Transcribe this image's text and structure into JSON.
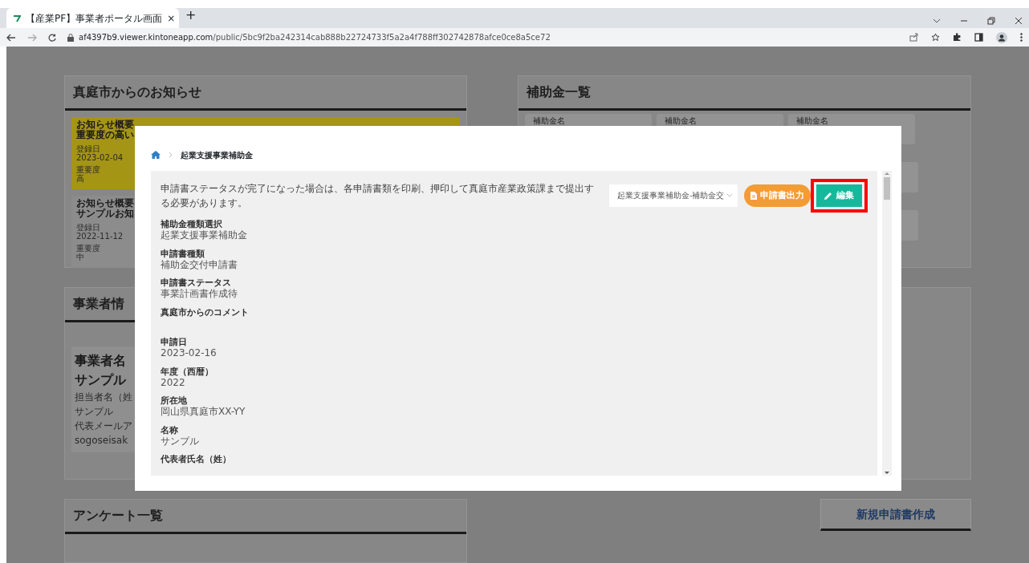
{
  "browser": {
    "tab_title": "【産業PF】事業者ポータル画面",
    "tab_close": "×",
    "new_tab": "+",
    "url_host": "af4397b9.viewer.kintoneapp.com",
    "url_path": "/public/5bc9f2ba242314cab888b22724733f5a2a4f788ff302742878afce0ce8a5ce72"
  },
  "page": {
    "notices": {
      "title": "真庭市からのお知らせ",
      "items": [
        {
          "lines": [
            "お知らせ概要",
            "重要度の高い"
          ],
          "date_label": "登録日",
          "date": "2023-02-04",
          "importance_label": "重要度",
          "importance": "高",
          "color": "#a59515"
        },
        {
          "lines": [
            "お知らせ概要",
            "サンプルお知"
          ],
          "date_label": "登録日",
          "date": "2022-11-12",
          "importance_label": "重要度",
          "importance": "中",
          "color": "#8c8c8c"
        }
      ]
    },
    "business": {
      "title": "事業者情",
      "card": {
        "name_label": "事業者名",
        "name": "サンプル",
        "lines": [
          "担当者名（姓",
          "サンプル",
          "代表メールア",
          "sogoseisak"
        ]
      }
    },
    "survey": {
      "title": "アンケート一覧"
    },
    "subsidies": {
      "title": "補助金一覧",
      "cards": [
        {
          "label": "補助金名"
        },
        {
          "label": "補助金名"
        },
        {
          "label": "補助金名"
        }
      ]
    },
    "new_button": "新規申請書作成"
  },
  "modal": {
    "breadcrumb": "起業支援事業補助金",
    "notice": "申請書ステータスが完了になった場合は、各申請書類を印刷、押印して真庭市産業政策課まで提出する必要があります。",
    "select": {
      "value": "起業支援事業補助金-補助金交"
    },
    "buttons": [
      {
        "kind": "output",
        "label": "申請書出力",
        "highlighted": false
      },
      {
        "kind": "edit",
        "label": "編集",
        "highlighted": true
      }
    ],
    "fields": [
      {
        "label": "補助金種類選択",
        "value": "起業支援事業補助金"
      },
      {
        "label": "申請書種類",
        "value": "補助金交付申請書"
      },
      {
        "label": "申請書ステータス",
        "value": "事業計画書作成待"
      },
      {
        "label": "真庭市からのコメント"
      },
      {
        "label": "申請日",
        "value": "2023-02-16"
      },
      {
        "label": "年度（西暦）",
        "value": "2022"
      },
      {
        "label": "所在地",
        "value": "岡山県真庭市XX-YY"
      },
      {
        "label": "名称",
        "value": "サンプル"
      },
      {
        "label": "代表者氏名（姓）"
      }
    ]
  }
}
